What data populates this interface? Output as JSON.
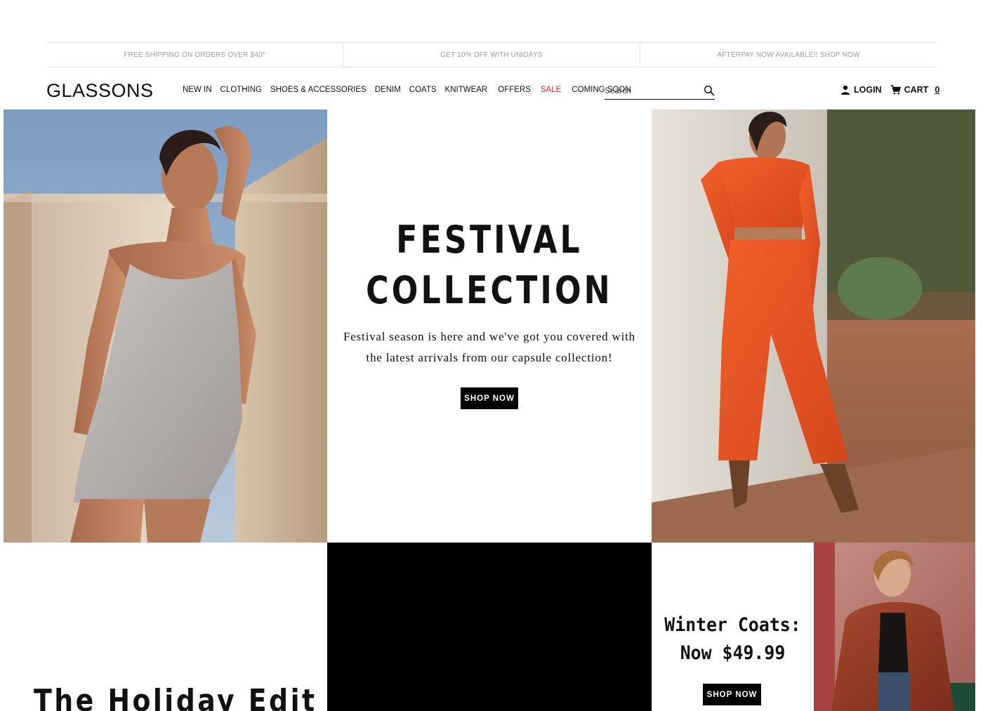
{
  "promos": [
    "FREE SHIPPING ON ORDERS OVER $40*",
    "GET 10% OFF WITH UNIDAYS",
    "AFTERPAY NOW AVAILABLE!! SHOP NOW"
  ],
  "header": {
    "logo": "GLASSONS",
    "nav": [
      {
        "label": "NEW IN"
      },
      {
        "label": "CLOTHING"
      },
      {
        "label": "SHOES & ACCESSORIES"
      },
      {
        "label": "DENIM"
      },
      {
        "label": "COATS"
      },
      {
        "label": "KNITWEAR"
      },
      {
        "label": "OFFERS"
      },
      {
        "label": "SALE",
        "color": "#d62020"
      },
      {
        "label": "COMING SOON"
      }
    ],
    "search_placeholder": "Search",
    "login_label": "LOGIN",
    "cart_label": "CART",
    "cart_count": "0"
  },
  "hero": {
    "title_line1": "FESTIVAL",
    "title_line2": "COLLECTION",
    "description": "Festival season is here and we've got you covered with the latest arrivals from our capsule collection!",
    "cta": "SHOP NOW"
  },
  "holiday": {
    "title": "The Holiday Edit"
  },
  "coats": {
    "title_line1": "Winter Coats:",
    "title_line2": "Now $49.99",
    "cta": "SHOP NOW"
  },
  "colors": {
    "accent_sale": "#d62020",
    "button_bg": "#000000",
    "promo_text": "#9a9a9a"
  }
}
